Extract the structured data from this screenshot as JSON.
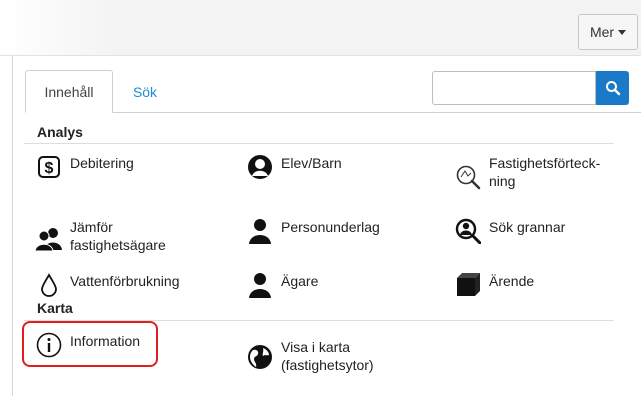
{
  "header": {
    "more_button_label": "Mer"
  },
  "tabs": [
    {
      "label": "Innehåll",
      "active": true
    },
    {
      "label": "Sök",
      "active": false
    }
  ],
  "search": {
    "value": "",
    "placeholder": ""
  },
  "sections": [
    {
      "title": "Analys",
      "items": [
        {
          "label": "Debitering",
          "icon": "dollar-icon"
        },
        {
          "label": "Elev/Barn",
          "icon": "person-circle-icon"
        },
        {
          "label": "Fastighetsförteck-\nning",
          "icon": "search-map-icon"
        },
        {
          "label": "Jämför\nfastighetsägare",
          "icon": "people-icon"
        },
        {
          "label": "Personunderlag",
          "icon": "person-icon"
        },
        {
          "label": "Sök grannar",
          "icon": "search-person-icon"
        },
        {
          "label": "Vattenförbrukning",
          "icon": "water-drop-icon"
        },
        {
          "label": "Ägare",
          "icon": "person-icon"
        },
        {
          "label": "Ärende",
          "icon": "cube-icon"
        }
      ]
    },
    {
      "title": "Karta",
      "items": [
        {
          "label": "Information",
          "icon": "info-icon"
        },
        {
          "label": "Visa i karta\n(fastighetsytor)",
          "icon": "globe-icon"
        }
      ]
    }
  ],
  "colors": {
    "accent": "#1a7ac7",
    "tab_link": "#1a8fd2",
    "highlight": "#e02020"
  }
}
